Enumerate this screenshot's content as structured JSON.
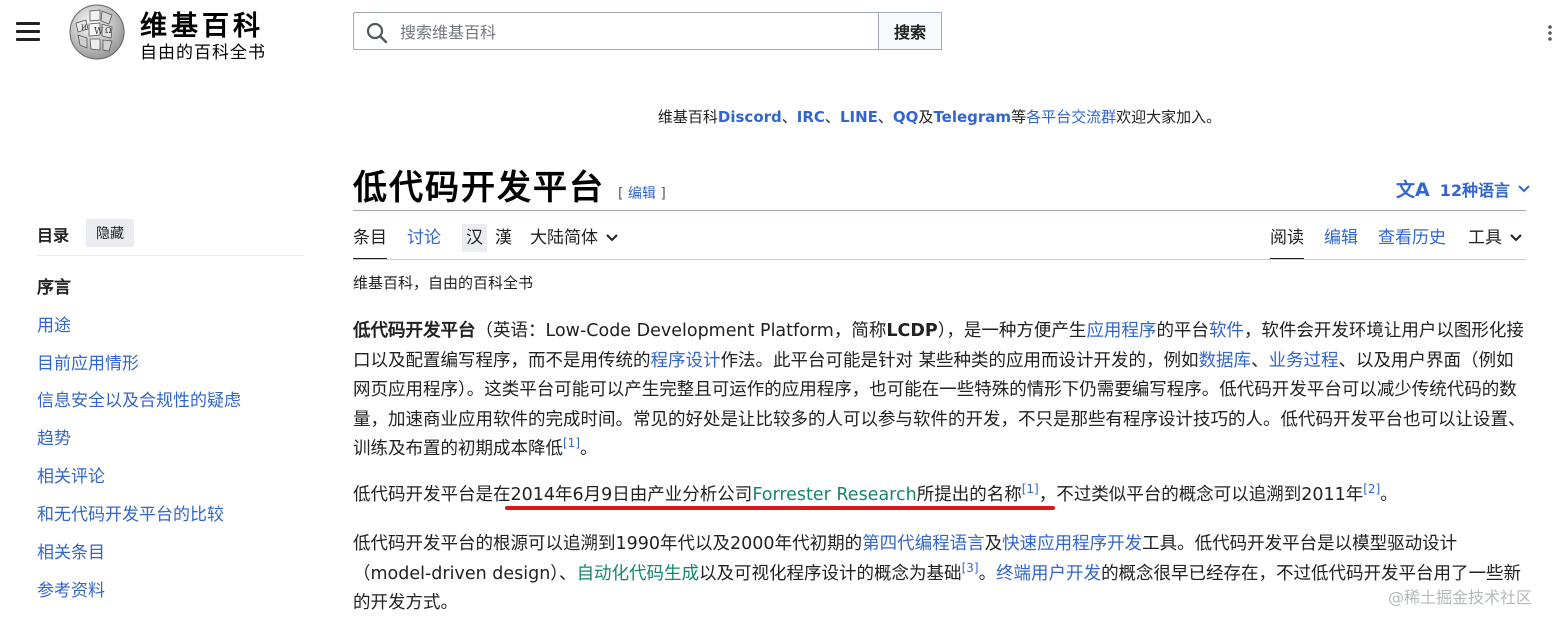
{
  "header": {
    "wordmark_title": "维基百科",
    "wordmark_tagline": "自由的百科全书",
    "search_placeholder": "搜索维基百科",
    "search_button": "搜索"
  },
  "sitenotice": {
    "prefix": "维基百科",
    "discord": "Discord",
    "sep1": "、",
    "irc": "IRC",
    "sep2": "、",
    "line": "LINE",
    "sep3": "、",
    "qq": "QQ",
    "and": "及",
    "telegram": "Telegram",
    "etc": "等",
    "groups_link": "各平台交流群",
    "suffix": "欢迎大家加入。"
  },
  "article": {
    "title": "低代码开发平台",
    "edit_open": "[",
    "edit_label": "编辑",
    "edit_close": "]",
    "languages": "12种语言",
    "from": "维基百科，自由的百科全书"
  },
  "tabs": {
    "article": "条目",
    "talk": "讨论",
    "variant_simplified": "汉",
    "variant_traditional": "漢",
    "variant_select": "大陆简体",
    "read": "阅读",
    "edit": "编辑",
    "history": "查看历史",
    "tools": "工具"
  },
  "toc": {
    "heading": "目录",
    "hide": "隐藏",
    "items": [
      "序言",
      "用途",
      "目前应用情形",
      "信息安全以及合规性的疑虑",
      "趋势",
      "相关评论",
      "和无代码开发平台的比较",
      "相关条目",
      "参考资料"
    ]
  },
  "paragraphs": {
    "p1": {
      "t1": "低代码开发平台",
      "t2": "（英语：Low-Code Development Platform，简称",
      "t3": "LCDP",
      "t4": "），是一种方便产生",
      "l1": "应用程序",
      "t5": "的平台",
      "l2": "软件",
      "t6": "，软件会开发环境让用户以图形化接口以及配置编写程序，而不是用传统的",
      "l3": "程序设计",
      "t7": "作法。此平台可能是针对 某些种类的应用而设计开发的，例如",
      "l4": "数据库",
      "t8": "、",
      "l5": "业务过程",
      "t9": "、以及用户界面（例如网页应用程序）。这类平台可能可以产生完整且可运作的应用程序，也可能在一些特殊的情形下仍需要编写程序。低代码开发平台可以减少传统代码的数量，加速商业应用软件的完成时间。常见的好处是让比较多的人可以参与软件的开发，不只是那些有程序设计技巧的人。低代码开发平台也可以让设置、训练及布置的初期成本降低",
      "ref1": "[1]",
      "t10": "。"
    },
    "p2": {
      "t1": "低代码开发平台是在2014年6月9日由产业分析公司",
      "l1": "Forrester Research",
      "t2": "所提出的名称",
      "ref1": "[1]",
      "t3": "，不过类似平台的概念可以追溯到2011年",
      "ref2": "[2]",
      "t4": "。"
    },
    "p3": {
      "t1": "低代码开发平台的根源可以追溯到1990年代以及2000年代初期的",
      "l1": "第四代编程语言",
      "t2": "及",
      "l2": "快速应用程序开发",
      "t3": "工具。低代码开发平台是以模型驱动设计（model-driven design）、",
      "l3": "自动化代码生成",
      "t4": "以及可视化程序设计的概念为基础",
      "ref1": "[3]",
      "t5": "。",
      "l4": "终端用户开发",
      "t6": "的概念很早已经存在，不过低代码开发平台用了一些新的开发方式。"
    }
  },
  "watermark": "@稀土掘金技术社区"
}
